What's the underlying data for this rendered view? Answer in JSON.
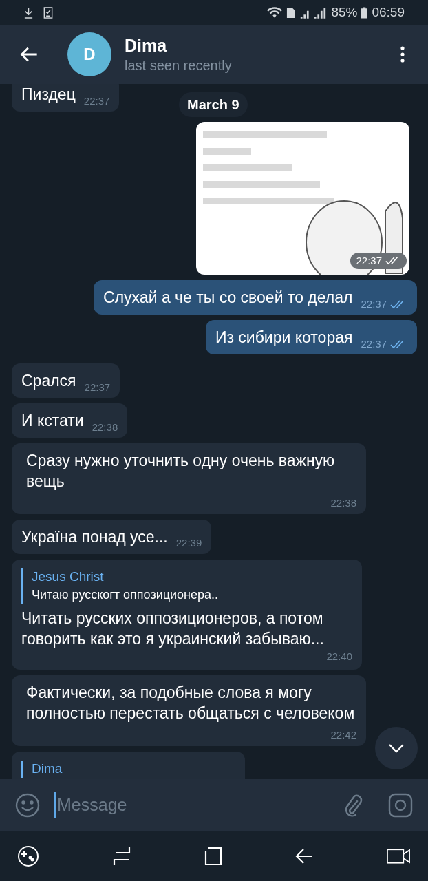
{
  "status_bar": {
    "battery": "85%",
    "time": "06:59"
  },
  "header": {
    "avatar_letter": "D",
    "name": "Dima",
    "status": "last seen recently"
  },
  "date_badge": "March 9",
  "messages": [
    {
      "kind": "text",
      "outgoing": false,
      "text": "Пиздец",
      "time": "22:37"
    },
    {
      "outgoing": true,
      "time": "22:37",
      "read": true
    },
    {
      "kind": "text",
      "outgoing": true,
      "text": "Слухай а че ты со своей то делал",
      "time": "22:37",
      "read": true
    },
    {
      "kind": "text",
      "outgoing": true,
      "text": "Из сибири которая",
      "time": "22:37",
      "read": true
    },
    {
      "kind": "text",
      "outgoing": false,
      "text": "Срался",
      "time": "22:37"
    },
    {
      "kind": "text",
      "outgoing": false,
      "text": "И кстати",
      "time": "22:38"
    },
    {
      "kind": "text",
      "outgoing": false,
      "text": "Сразу нужно уточнить одну очень важную вещь",
      "time": "22:38"
    },
    {
      "kind": "text",
      "outgoing": false,
      "text": "Україна понад усе...",
      "time": "22:39"
    },
    {
      "kind": "reply",
      "outgoing": false,
      "reply_author": "Jesus Christ",
      "reply_text": "Читаю русскогт оппозиционера..",
      "text": "Читать русских оппозиционеров, а потом говорить как это я украинский забываю...",
      "time": "22:40"
    },
    {
      "kind": "text",
      "outgoing": false,
      "text": "Фактически, за подобные слова я могу полностью перестать общаться с человеком",
      "time": "22:42"
    },
    {
      "kind": "reply_cut",
      "outgoing": false,
      "reply_author": "Dima"
    }
  ],
  "input": {
    "placeholder": "Message"
  }
}
